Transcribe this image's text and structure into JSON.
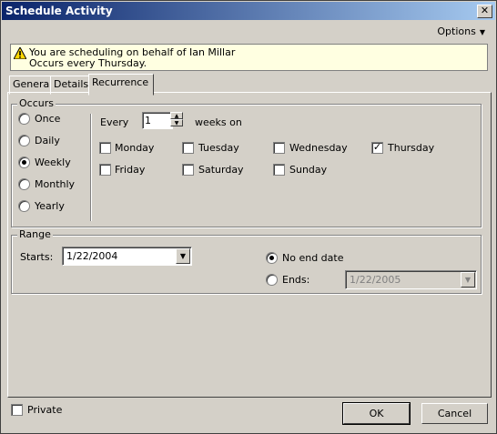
{
  "window": {
    "title": "Schedule Activity",
    "close_glyph": "✕"
  },
  "menu": {
    "options_label": "Options"
  },
  "notice": {
    "line1": "You are scheduling on behalf of Ian Millar",
    "line2": "Occurs every Thursday."
  },
  "tabs": [
    {
      "label": "General"
    },
    {
      "label": "Details"
    },
    {
      "label": "Recurrence",
      "active": true
    }
  ],
  "occurs": {
    "title": "Occurs",
    "options": [
      "Once",
      "Daily",
      "Weekly",
      "Monthly",
      "Yearly"
    ],
    "selected": "Weekly"
  },
  "every": {
    "label": "Every",
    "value": "1",
    "suffix": "weeks on"
  },
  "days": [
    {
      "label": "Monday",
      "checked": false
    },
    {
      "label": "Tuesday",
      "checked": false
    },
    {
      "label": "Wednesday",
      "checked": false
    },
    {
      "label": "Thursday",
      "checked": true
    },
    {
      "label": "Friday",
      "checked": false
    },
    {
      "label": "Saturday",
      "checked": false
    },
    {
      "label": "Sunday",
      "checked": false
    }
  ],
  "range": {
    "title": "Range",
    "starts_label": "Starts:",
    "starts_value": "1/22/2004",
    "no_end_label": "No end date",
    "ends_label": "Ends:",
    "ends_value": "1/22/2005",
    "selected": "no_end"
  },
  "footer": {
    "private_label": "Private",
    "ok_label": "OK",
    "cancel_label": "Cancel"
  }
}
